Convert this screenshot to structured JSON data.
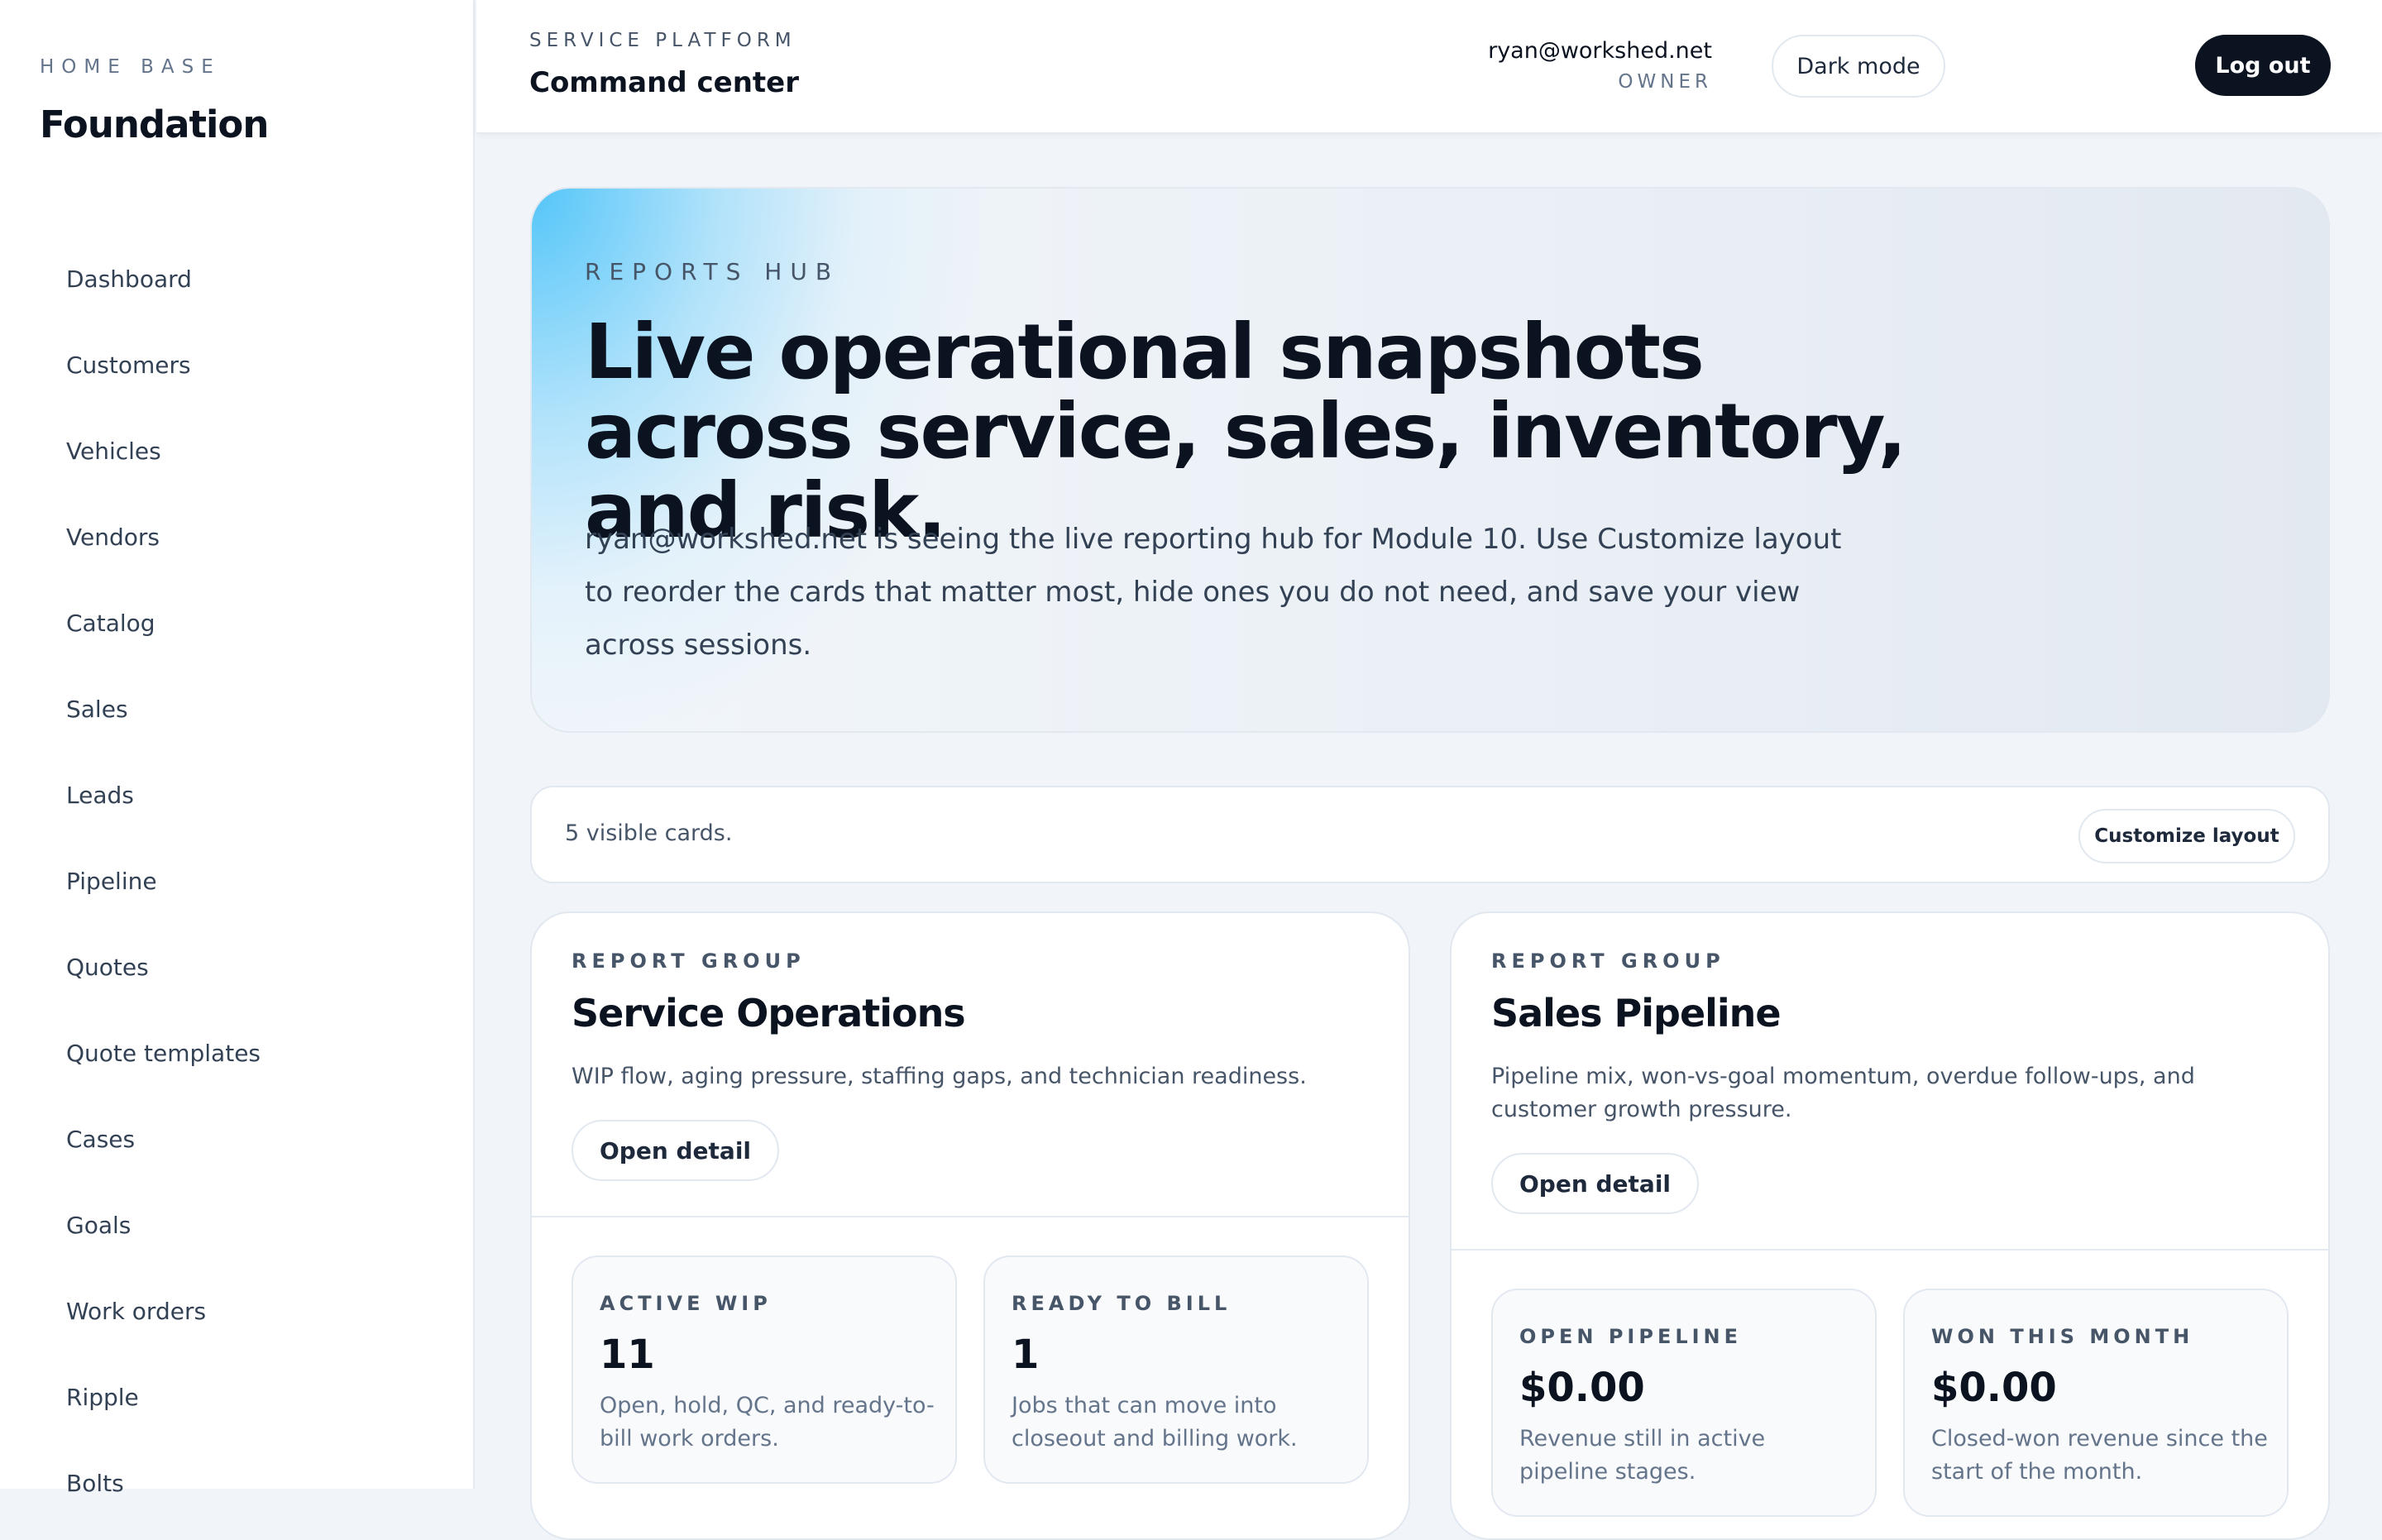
{
  "sidebar": {
    "eyebrow": "HOME BASE",
    "title": "Foundation",
    "items": [
      {
        "label": "Dashboard"
      },
      {
        "label": "Customers"
      },
      {
        "label": "Vehicles"
      },
      {
        "label": "Vendors"
      },
      {
        "label": "Catalog"
      },
      {
        "label": "Sales"
      },
      {
        "label": "Leads"
      },
      {
        "label": "Pipeline"
      },
      {
        "label": "Quotes"
      },
      {
        "label": "Quote templates"
      },
      {
        "label": "Cases"
      },
      {
        "label": "Goals"
      },
      {
        "label": "Work orders"
      },
      {
        "label": "Ripple"
      },
      {
        "label": "Bolts"
      }
    ]
  },
  "topbar": {
    "eyebrow": "SERVICE PLATFORM",
    "title": "Command center",
    "dark_mode_label": "Dark mode",
    "user_email": "ryan@workshed.net",
    "user_role": "OWNER",
    "logout_label": "Log out"
  },
  "hero": {
    "eyebrow": "REPORTS HUB",
    "title": "Live operational snapshots across service, sales, inventory, and risk.",
    "description": "ryan@workshed.net is seeing the live reporting hub for Module 10. Use Customize layout to reorder the cards that matter most, hide ones you do not need, and save your view across sessions."
  },
  "cards_bar": {
    "count_text": "5 visible cards.",
    "customize_label": "Customize layout"
  },
  "report_groups": [
    {
      "eyebrow": "REPORT GROUP",
      "title": "Service Operations",
      "description": "WIP flow, aging pressure, staffing gaps, and technician readiness.",
      "open_label": "Open detail",
      "metrics": [
        {
          "label": "ACTIVE WIP",
          "value": "11",
          "description": "Open, hold, QC, and ready-to-bill work orders."
        },
        {
          "label": "READY TO BILL",
          "value": "1",
          "description": "Jobs that can move into closeout and billing work."
        }
      ]
    },
    {
      "eyebrow": "REPORT GROUP",
      "title": "Sales Pipeline",
      "description": "Pipeline mix, won-vs-goal momentum, overdue follow-ups, and customer growth pressure.",
      "open_label": "Open detail",
      "metrics": [
        {
          "label": "OPEN PIPELINE",
          "value": "$0.00",
          "description": "Revenue still in active pipeline stages."
        },
        {
          "label": "WON THIS MONTH",
          "value": "$0.00",
          "description": "Closed-won revenue since the start of the month."
        }
      ]
    }
  ]
}
